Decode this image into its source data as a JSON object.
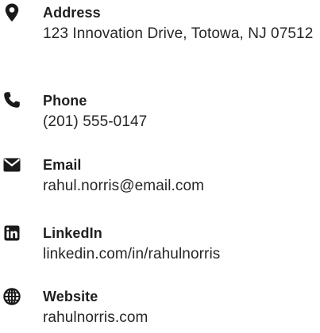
{
  "contacts": [
    {
      "icon": "map-pin-icon",
      "label": "Address",
      "value": "123 Innovation Drive, Totowa, NJ 07512"
    },
    {
      "icon": "phone-icon",
      "label": "Phone",
      "value": "(201) 555-0147"
    },
    {
      "icon": "envelope-icon",
      "label": "Email",
      "value": "rahul.norris@email.com"
    },
    {
      "icon": "linkedin-icon",
      "label": "LinkedIn",
      "value": "linkedin.com/in/rahulnorris"
    },
    {
      "icon": "globe-icon",
      "label": "Website",
      "value": "rahulnorris.com"
    }
  ],
  "colors": {
    "icon": "#1a1a1a",
    "label": "#1f1f1f",
    "value": "#262626",
    "background": "#ffffff"
  }
}
